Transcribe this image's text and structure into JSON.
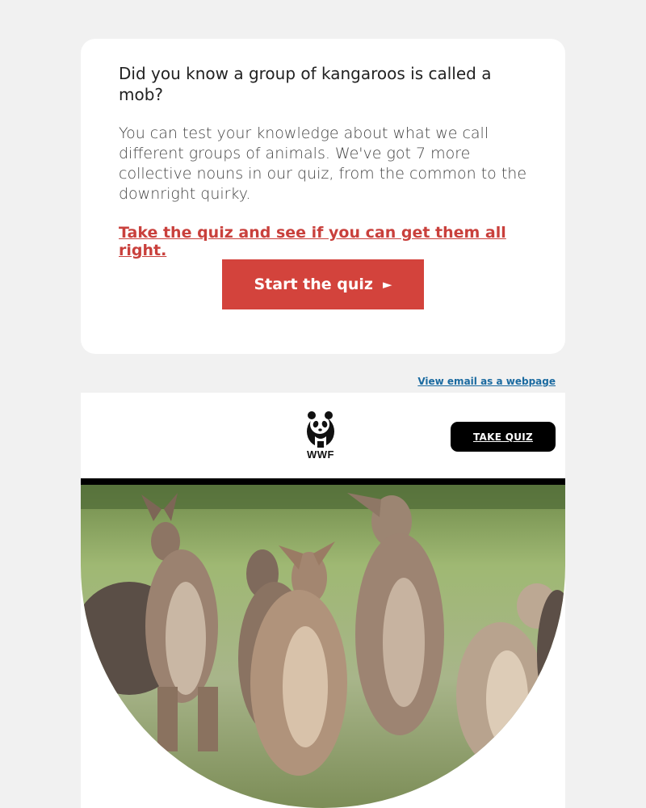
{
  "card": {
    "headline": "Did you know a group of kangaroos is called a mob?",
    "body": "You can test your knowledge about what we call different groups of animals. We've got 7 more collective nouns in our quiz, from the common to the downright quirky.",
    "link_text": "Take the quiz and see if you can get them all right.",
    "button_label": "Start the quiz",
    "button_arrow": "►"
  },
  "header": {
    "view_webpage": "View email as a webpage",
    "logo_text": "WWF",
    "take_quiz_label": "TAKE QUIZ"
  },
  "hero": {
    "image": "kangaroo-mob-photo"
  },
  "colors": {
    "accent": "#d3433c",
    "link": "#c9403c",
    "view_link": "#1a6aa0",
    "background": "#f1f1f1"
  }
}
